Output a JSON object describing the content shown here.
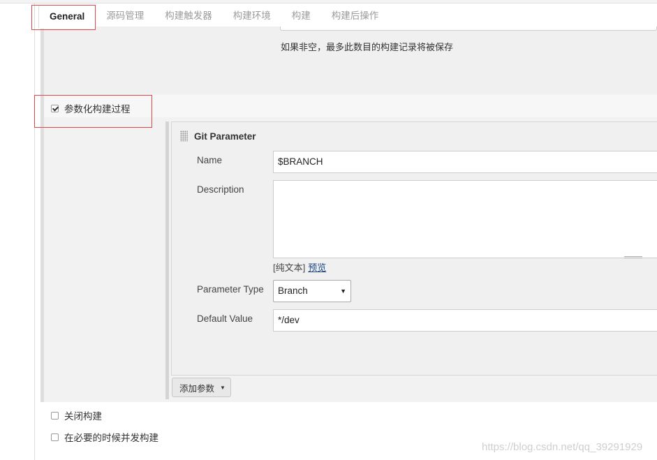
{
  "tabs": [
    {
      "label": "General",
      "active": true
    },
    {
      "label": "源码管理"
    },
    {
      "label": "构建触发器"
    },
    {
      "label": "构建环境"
    },
    {
      "label": "构建"
    },
    {
      "label": "构建后操作"
    }
  ],
  "discard": {
    "hint": "如果非空，最多此数目的构建记录将被保存"
  },
  "parameterized": {
    "label": "参数化构建过程",
    "checked": true
  },
  "git_parameter": {
    "title": "Git Parameter",
    "name_label": "Name",
    "name_value": "$BRANCH",
    "description_label": "Description",
    "description_value": "",
    "format_plain": "[纯文本]",
    "format_preview": "预览",
    "type_label": "Parameter Type",
    "type_value": "Branch",
    "default_label": "Default Value",
    "default_value": "*/dev"
  },
  "add_param_button": "添加参数",
  "options": [
    {
      "label": "关闭构建",
      "checked": false
    },
    {
      "label": "在必要的时候并发构建",
      "checked": false
    }
  ],
  "watermark": "https://blog.csdn.net/qq_39291929",
  "colors": {
    "highlight": "#e0474c",
    "link": "#204a87"
  }
}
